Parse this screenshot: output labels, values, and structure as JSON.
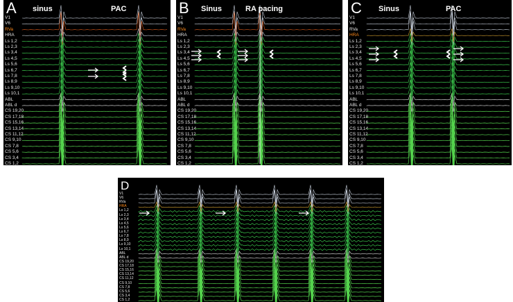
{
  "panels": [
    {
      "id": "A",
      "letter": "A",
      "annotations": [
        {
          "text": "sinus"
        },
        {
          "text": "PAC"
        }
      ],
      "channels": [
        "V1",
        "V6",
        "RVa",
        "HRA",
        "Ls 1,2",
        "Ls 2,3",
        "Ls 3,4",
        "Ls 4,5",
        "Ls 5,6",
        "Ls 6,7",
        "Ls 7,8",
        "Ls 8,9",
        "Ls 9,10",
        "Ls 10,1",
        "ABL",
        "ABL d",
        "CS 19,20",
        "CS 17,18",
        "CS 15,16",
        "CS 13,14",
        "CS 11,12",
        "CS 9,10",
        "CS 7,8",
        "CS 5,6",
        "CS 3,4",
        "CS 1,2"
      ],
      "highlight": [
        "RVa"
      ]
    },
    {
      "id": "B",
      "letter": "B",
      "annotations": [
        {
          "text": "Sinus"
        },
        {
          "text": "RA pacing"
        }
      ],
      "channels": [
        "V1",
        "V6",
        "RVa",
        "HRA",
        "Ls 1,2",
        "Ls 2,3",
        "Ls 3,4",
        "Ls 4,5",
        "Ls 5,6",
        "Ls 6,7",
        "Ls 7,8",
        "Ls 8,9",
        "Ls 9,10",
        "Ls 10,1",
        "ABL",
        "ABL d",
        "CS 19,20",
        "CS 17,18",
        "CS 15,16",
        "CS 13,14",
        "CS 11,12",
        "CS 9,10",
        "CS 7,8",
        "CS 5,6",
        "CS 3,4",
        "CS 1,2"
      ],
      "highlight": [
        "RVa"
      ]
    },
    {
      "id": "C",
      "letter": "C",
      "annotations": [
        {
          "text": "Sinus"
        },
        {
          "text": "PAC"
        }
      ],
      "channels": [
        "V1",
        "V6",
        "RVa",
        "HRA",
        "Ls 1,2",
        "Ls 2,3",
        "Ls 3,4",
        "Ls 4,5",
        "Ls 5,6",
        "Ls 6,7",
        "Ls 7,8",
        "Ls 8,9",
        "Ls 9,10",
        "Ls 10,1",
        "ABL",
        "ABL d",
        "CS 19,20",
        "CS 17,18",
        "CS 15,16",
        "CS 13,14",
        "CS 11,12",
        "CS 9,10",
        "CS 7,8",
        "CS 5,6",
        "CS 3,4",
        "CS 1,2"
      ],
      "highlight": [
        "HRA"
      ]
    },
    {
      "id": "D",
      "letter": "D",
      "annotations": [],
      "channels": [
        "V1",
        "V6",
        "RVa",
        "HRA",
        "Ls 1,2",
        "Ls 2,3",
        "Ls 3,4",
        "Ls 4,5",
        "Ls 5,6",
        "Ls 6,7",
        "Ls 7,8",
        "Ls 8,9",
        "Ls 9,10",
        "Ls 10,1",
        "ABL",
        "ABL d",
        "CS 19,20",
        "CS 17,18",
        "CS 15,16",
        "CS 13,14",
        "CS 11,12",
        "CS 9,10",
        "CS 7,8",
        "CS 5,6",
        "CS 3,4",
        "CS 1,2"
      ],
      "highlight": [
        "HRA"
      ]
    }
  ],
  "colors": {
    "background": "#000000",
    "surface": "#c8d0dc",
    "ventricular": "#ff7a1a",
    "rva": "#e05b1a",
    "hra": "#d8a430",
    "lasso": "#39c24a",
    "abl": "#e6e6e6",
    "cs": "#55d44e",
    "magenta": "#d23cd2",
    "arrow": "#ffffff"
  }
}
